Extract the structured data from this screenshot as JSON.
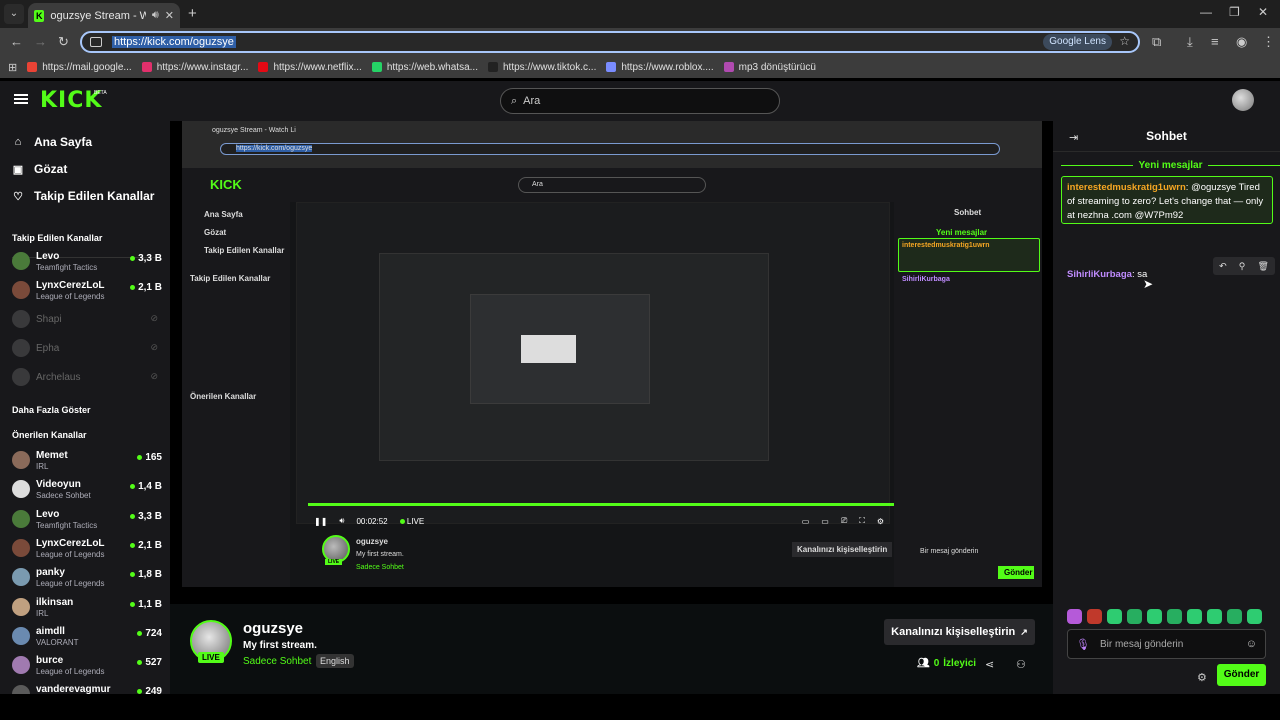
{
  "browser": {
    "tab_title": "oguzsye Stream - Watch Li",
    "url": "https://kick.com/oguzsye",
    "lens_label": "Google Lens",
    "bookmarks": [
      {
        "label": "https://mail.google...",
        "color": "#ea4335"
      },
      {
        "label": "https://www.instagr...",
        "color": "#e1306c"
      },
      {
        "label": "https://www.netflix...",
        "color": "#e50914"
      },
      {
        "label": "https://web.whatsa...",
        "color": "#25d366"
      },
      {
        "label": "https://www.tiktok.c...",
        "color": "#222222"
      },
      {
        "label": "https://www.roblox....",
        "color": "#7a8cff"
      },
      {
        "label": "mp3 dönüştürücü",
        "color": "#b04ab0"
      }
    ]
  },
  "header": {
    "logo": "KICK",
    "beta": "BETA",
    "search_placeholder": "Ara"
  },
  "sidebar": {
    "nav": [
      {
        "label": "Ana Sayfa",
        "icon": "home-icon"
      },
      {
        "label": "Gözat",
        "icon": "browse-icon"
      },
      {
        "label": "Takip Edilen Kanallar",
        "icon": "heart-icon"
      }
    ],
    "following_title": "Takip Edilen Kanallar",
    "following": [
      {
        "name": "Levo",
        "sub": "Teamfight Tactics",
        "viewers": "3,3 B",
        "live": true,
        "color": "#4a7a3a"
      },
      {
        "name": "LynxCerezLoL",
        "sub": "League of Legends",
        "viewers": "2,1 B",
        "live": true,
        "color": "#7a4a3a"
      },
      {
        "name": "Shapi",
        "sub": "",
        "viewers": "",
        "live": false,
        "color": "#777777"
      },
      {
        "name": "Epha",
        "sub": "",
        "viewers": "",
        "live": false,
        "color": "#777777"
      },
      {
        "name": "Archelaus",
        "sub": "",
        "viewers": "",
        "live": false,
        "color": "#777777"
      }
    ],
    "show_more": "Daha Fazla Göster",
    "recommended_title": "Önerilen Kanallar",
    "recommended": [
      {
        "name": "Memet",
        "sub": "IRL",
        "viewers": "165",
        "color": "#8a6a5a"
      },
      {
        "name": "Videoyun",
        "sub": "Sadece Sohbet",
        "viewers": "1,4 B",
        "color": "#dddddd"
      },
      {
        "name": "Levo",
        "sub": "Teamfight Tactics",
        "viewers": "3,3 B",
        "color": "#4a7a3a"
      },
      {
        "name": "LynxCerezLoL",
        "sub": "League of Legends",
        "viewers": "2,1 B",
        "color": "#7a4a3a"
      },
      {
        "name": "panky",
        "sub": "League of Legends",
        "viewers": "1,8 B",
        "color": "#7a9ab0"
      },
      {
        "name": "ilkinsan",
        "sub": "IRL",
        "viewers": "1,1 B",
        "color": "#c0a080"
      },
      {
        "name": "aimdll",
        "sub": "VALORANT",
        "viewers": "724",
        "color": "#6a8ab0"
      },
      {
        "name": "burce",
        "sub": "League of Legends",
        "viewers": "527",
        "color": "#a07ab0"
      },
      {
        "name": "vanderevagmur",
        "sub": "",
        "viewers": "249",
        "color": "#5a5a5a"
      }
    ]
  },
  "player": {
    "time": "00:02:52",
    "live": "LIVE"
  },
  "channel": {
    "name": "oguzsye",
    "title": "My first stream.",
    "category": "Sadece Sohbet",
    "language": "English",
    "live_badge": "LIVE",
    "customize_label": "Kanalınızı kişiselleştirin",
    "viewers_count": "0",
    "viewers_label": "İzleyici"
  },
  "chat": {
    "title": "Sohbet",
    "new_messages": "Yeni mesajlar",
    "messages": [
      {
        "user": "interestedmuskratig1uwrn",
        "text": "@oguzsye Tired of streaming to zero? Let's change that — only at nezhna .com @W7Pm92"
      },
      {
        "user": "SihirliKurbaga",
        "text": "sa"
      }
    ],
    "input_placeholder": "Bir mesaj gönderin",
    "send_label": "Gönder",
    "emote_colors": [
      "#b55ad9",
      "#c0392b",
      "#2ecc71",
      "#27ae60",
      "#2ecc71",
      "#27ae60",
      "#2ecc71",
      "#2ecc71",
      "#27ae60",
      "#2ecc71"
    ]
  },
  "colors": {
    "accent": "#53fc18",
    "background": "#0b0e0f",
    "panel": "#18181b"
  }
}
